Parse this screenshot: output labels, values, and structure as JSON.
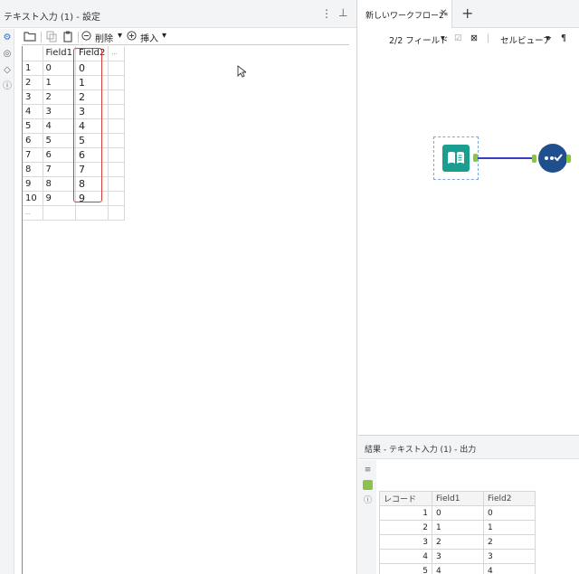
{
  "config_panel": {
    "title": "テキスト入力 (1) - 設定",
    "toolbar": {
      "delete_label": "削除",
      "insert_label": "挿入"
    },
    "grid": {
      "columns": [
        "Field1",
        "Field2",
        "..."
      ],
      "rows": [
        {
          "n": "1",
          "f1": "0",
          "f2": "0"
        },
        {
          "n": "2",
          "f1": "1",
          "f2": "1"
        },
        {
          "n": "3",
          "f1": "2",
          "f2": "2"
        },
        {
          "n": "4",
          "f1": "3",
          "f2": "3"
        },
        {
          "n": "5",
          "f1": "4",
          "f2": "4"
        },
        {
          "n": "6",
          "f1": "5",
          "f2": "5"
        },
        {
          "n": "7",
          "f1": "6",
          "f2": "6"
        },
        {
          "n": "8",
          "f1": "7",
          "f2": "7"
        },
        {
          "n": "9",
          "f1": "8",
          "f2": "8"
        },
        {
          "n": "10",
          "f1": "9",
          "f2": "9"
        }
      ],
      "new_row": "..."
    }
  },
  "canvas": {
    "tab_label": "新しいワークフロー2*"
  },
  "results": {
    "title": "結果 - テキスト入力 (1) - 出力",
    "fields_label": "2/2 フィールド",
    "viewer_label": "セルビューア",
    "columns": [
      "レコード",
      "Field1",
      "Field2"
    ],
    "rows": [
      {
        "n": "1",
        "f1": "0",
        "f2": "0"
      },
      {
        "n": "2",
        "f1": "1",
        "f2": "1"
      },
      {
        "n": "3",
        "f1": "2",
        "f2": "2"
      },
      {
        "n": "4",
        "f1": "3",
        "f2": "3"
      },
      {
        "n": "5",
        "f1": "4",
        "f2": "4"
      }
    ]
  },
  "colors": {
    "accent": "#2a6fd6",
    "tool_green": "#1a9e8f",
    "tool_blue": "#1f4f8f",
    "highlight": "#d93b3b",
    "connector": "#3a3dbf"
  }
}
